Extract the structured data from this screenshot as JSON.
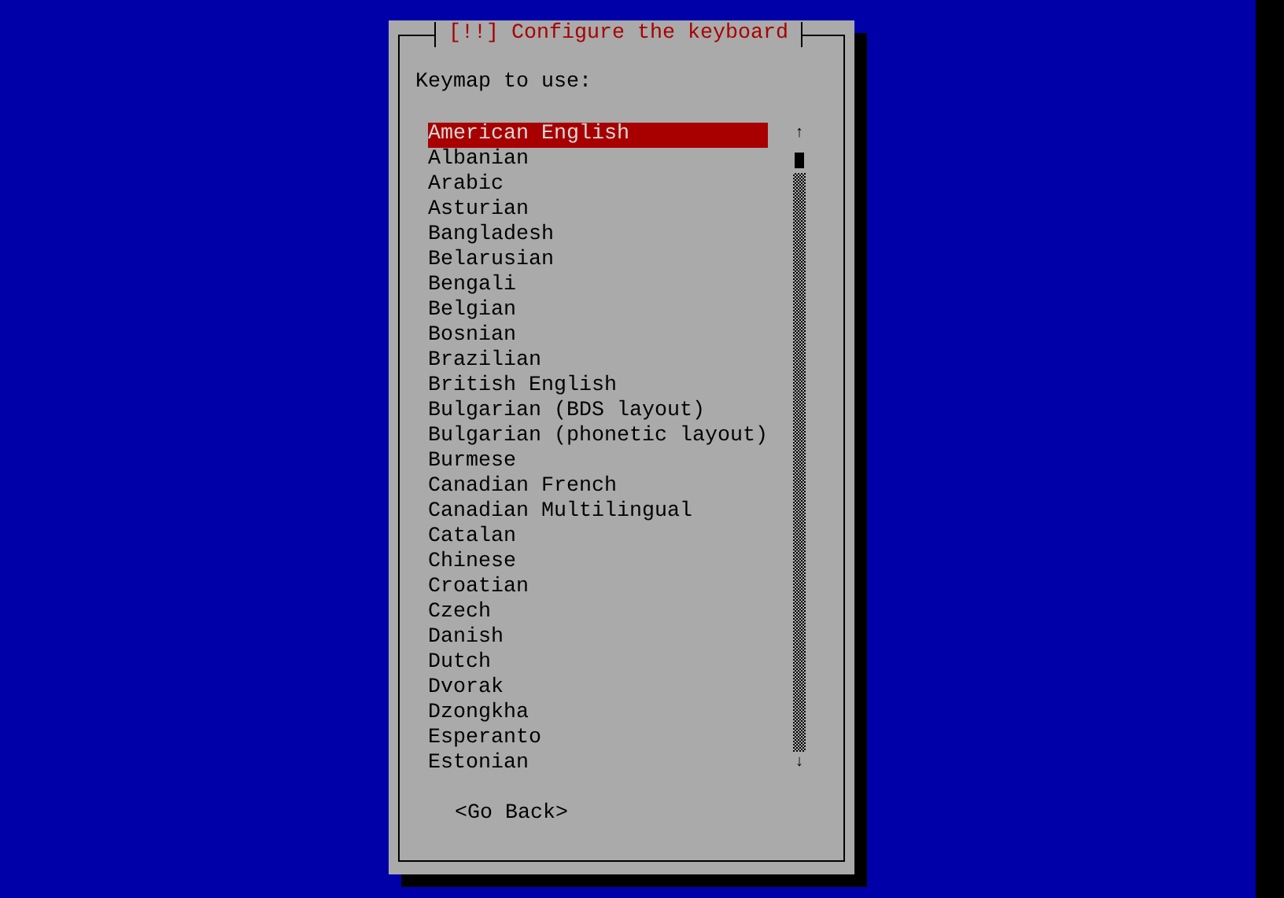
{
  "dialog": {
    "title": "[!!] Configure the keyboard",
    "prompt": "Keymap to use:",
    "keymaps": [
      {
        "label": "American English",
        "selected": true
      },
      {
        "label": "Albanian",
        "selected": false
      },
      {
        "label": "Arabic",
        "selected": false
      },
      {
        "label": "Asturian",
        "selected": false
      },
      {
        "label": "Bangladesh",
        "selected": false
      },
      {
        "label": "Belarusian",
        "selected": false
      },
      {
        "label": "Bengali",
        "selected": false
      },
      {
        "label": "Belgian",
        "selected": false
      },
      {
        "label": "Bosnian",
        "selected": false
      },
      {
        "label": "Brazilian",
        "selected": false
      },
      {
        "label": "British English",
        "selected": false
      },
      {
        "label": "Bulgarian (BDS layout)",
        "selected": false
      },
      {
        "label": "Bulgarian (phonetic layout)",
        "selected": false
      },
      {
        "label": "Burmese",
        "selected": false
      },
      {
        "label": "Canadian French",
        "selected": false
      },
      {
        "label": "Canadian Multilingual",
        "selected": false
      },
      {
        "label": "Catalan",
        "selected": false
      },
      {
        "label": "Chinese",
        "selected": false
      },
      {
        "label": "Croatian",
        "selected": false
      },
      {
        "label": "Czech",
        "selected": false
      },
      {
        "label": "Danish",
        "selected": false
      },
      {
        "label": "Dutch",
        "selected": false
      },
      {
        "label": "Dvorak",
        "selected": false
      },
      {
        "label": "Dzongkha",
        "selected": false
      },
      {
        "label": "Esperanto",
        "selected": false
      },
      {
        "label": "Estonian",
        "selected": false
      }
    ],
    "scroll_up": "↑",
    "scroll_down": "↓",
    "button": "<Go Back>"
  }
}
